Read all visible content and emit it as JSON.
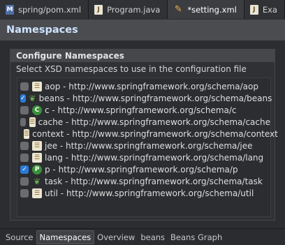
{
  "tabs": [
    {
      "label": "spring/pom.xml",
      "icon": "maven-icon"
    },
    {
      "label": "Program.java",
      "icon": "java-file-icon"
    },
    {
      "label": "*setting.xml",
      "icon": "xml-file-icon"
    },
    {
      "label": "Exa",
      "icon": "java-file-icon"
    }
  ],
  "header": {
    "title": "Namespaces"
  },
  "section": {
    "title": "Configure Namespaces",
    "description": "Select XSD namespaces to use in the configuration file"
  },
  "namespaces": [
    {
      "label": "aop - http://www.springframework.org/schema/aop",
      "checked": false,
      "icon": "aop-icon"
    },
    {
      "label": "beans - http://www.springframework.org/schema/beans",
      "checked": true,
      "icon": "beans-icon"
    },
    {
      "label": "c - http://www.springframework.org/schema/c",
      "checked": false,
      "icon": "c-namespace-icon"
    },
    {
      "label": "cache - http://www.springframework.org/schema/cache",
      "checked": false,
      "icon": "cache-icon"
    },
    {
      "label": "context - http://www.springframework.org/schema/context",
      "checked": false,
      "icon": "context-icon"
    },
    {
      "label": "jee - http://www.springframework.org/schema/jee",
      "checked": false,
      "icon": "jee-icon"
    },
    {
      "label": "lang - http://www.springframework.org/schema/lang",
      "checked": false,
      "icon": "lang-icon"
    },
    {
      "label": "p - http://www.springframework.org/schema/p",
      "checked": true,
      "icon": "p-namespace-icon"
    },
    {
      "label": "task - http://www.springframework.org/schema/task",
      "checked": false,
      "icon": "task-icon"
    },
    {
      "label": "util - http://www.springframework.org/schema/util",
      "checked": false,
      "icon": "util-icon"
    }
  ],
  "bottom_tabs": [
    {
      "label": "Source",
      "active": false
    },
    {
      "label": "Namespaces",
      "active": true
    },
    {
      "label": "Overview",
      "active": false
    },
    {
      "label": "beans",
      "active": false
    },
    {
      "label": "Beans Graph",
      "active": false
    }
  ],
  "colors": {
    "accent": "#2b7bd8",
    "header_text": "#cfe3ff"
  }
}
